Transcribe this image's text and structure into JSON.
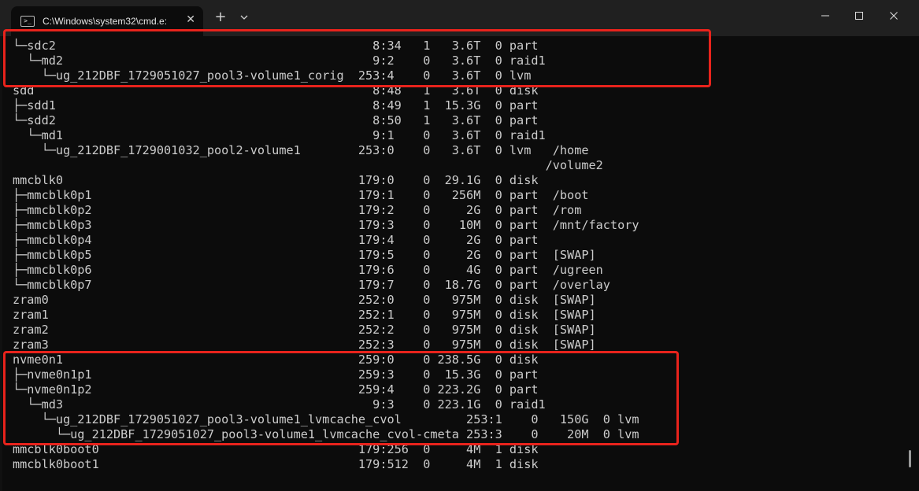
{
  "window": {
    "tab_title": "C:\\Windows\\system32\\cmd.e:",
    "tab_icon_glyph": ">_",
    "close_tab_glyph": "✕",
    "new_tab_glyph": "+"
  },
  "terminal": {
    "lines": [
      "└─sdc2                                            8:34   1   3.6T  0 part",
      "  └─md2                                           9:2    0   3.6T  0 raid1",
      "    └─ug_212DBF_1729051027_pool3-volume1_corig  253:4    0   3.6T  0 lvm",
      "sdd                                               8:48   1   3.6T  0 disk",
      "├─sdd1                                            8:49   1  15.3G  0 part",
      "└─sdd2                                            8:50   1   3.6T  0 part",
      "  └─md1                                           9:1    0   3.6T  0 raid1",
      "    └─ug_212DBF_1729001032_pool2-volume1        253:0    0   3.6T  0 lvm   /home",
      "                                                                          /volume2",
      "mmcblk0                                         179:0    0  29.1G  0 disk",
      "├─mmcblk0p1                                     179:1    0   256M  0 part  /boot",
      "├─mmcblk0p2                                     179:2    0     2G  0 part  /rom",
      "├─mmcblk0p3                                     179:3    0    10M  0 part  /mnt/factory",
      "├─mmcblk0p4                                     179:4    0     2G  0 part",
      "├─mmcblk0p5                                     179:5    0     2G  0 part  [SWAP]",
      "├─mmcblk0p6                                     179:6    0     4G  0 part  /ugreen",
      "└─mmcblk0p7                                     179:7    0  18.7G  0 part  /overlay",
      "zram0                                           252:0    0   975M  0 disk  [SWAP]",
      "zram1                                           252:1    0   975M  0 disk  [SWAP]",
      "zram2                                           252:2    0   975M  0 disk  [SWAP]",
      "zram3                                           252:3    0   975M  0 disk  [SWAP]",
      "nvme0n1                                         259:0    0 238.5G  0 disk",
      "├─nvme0n1p1                                     259:3    0  15.3G  0 part",
      "└─nvme0n1p2                                     259:4    0 223.2G  0 part",
      "  └─md3                                           9:3    0 223.1G  0 raid1",
      "    └─ug_212DBF_1729051027_pool3-volume1_lvmcache_cvol         253:1    0   150G  0 lvm",
      "      └─ug_212DBF_1729051027_pool3-volume1_lvmcache_cvol-cmeta 253:3    0    20M  0 lvm",
      "mmcblk0boot0                                    179:256  0     4M  1 disk",
      "mmcblk0boot1                                    179:512  0     4M  1 disk"
    ]
  },
  "colors": {
    "highlight": "#e8231c",
    "terminal_bg": "#0c0c0c",
    "terminal_fg": "#cccccc"
  }
}
